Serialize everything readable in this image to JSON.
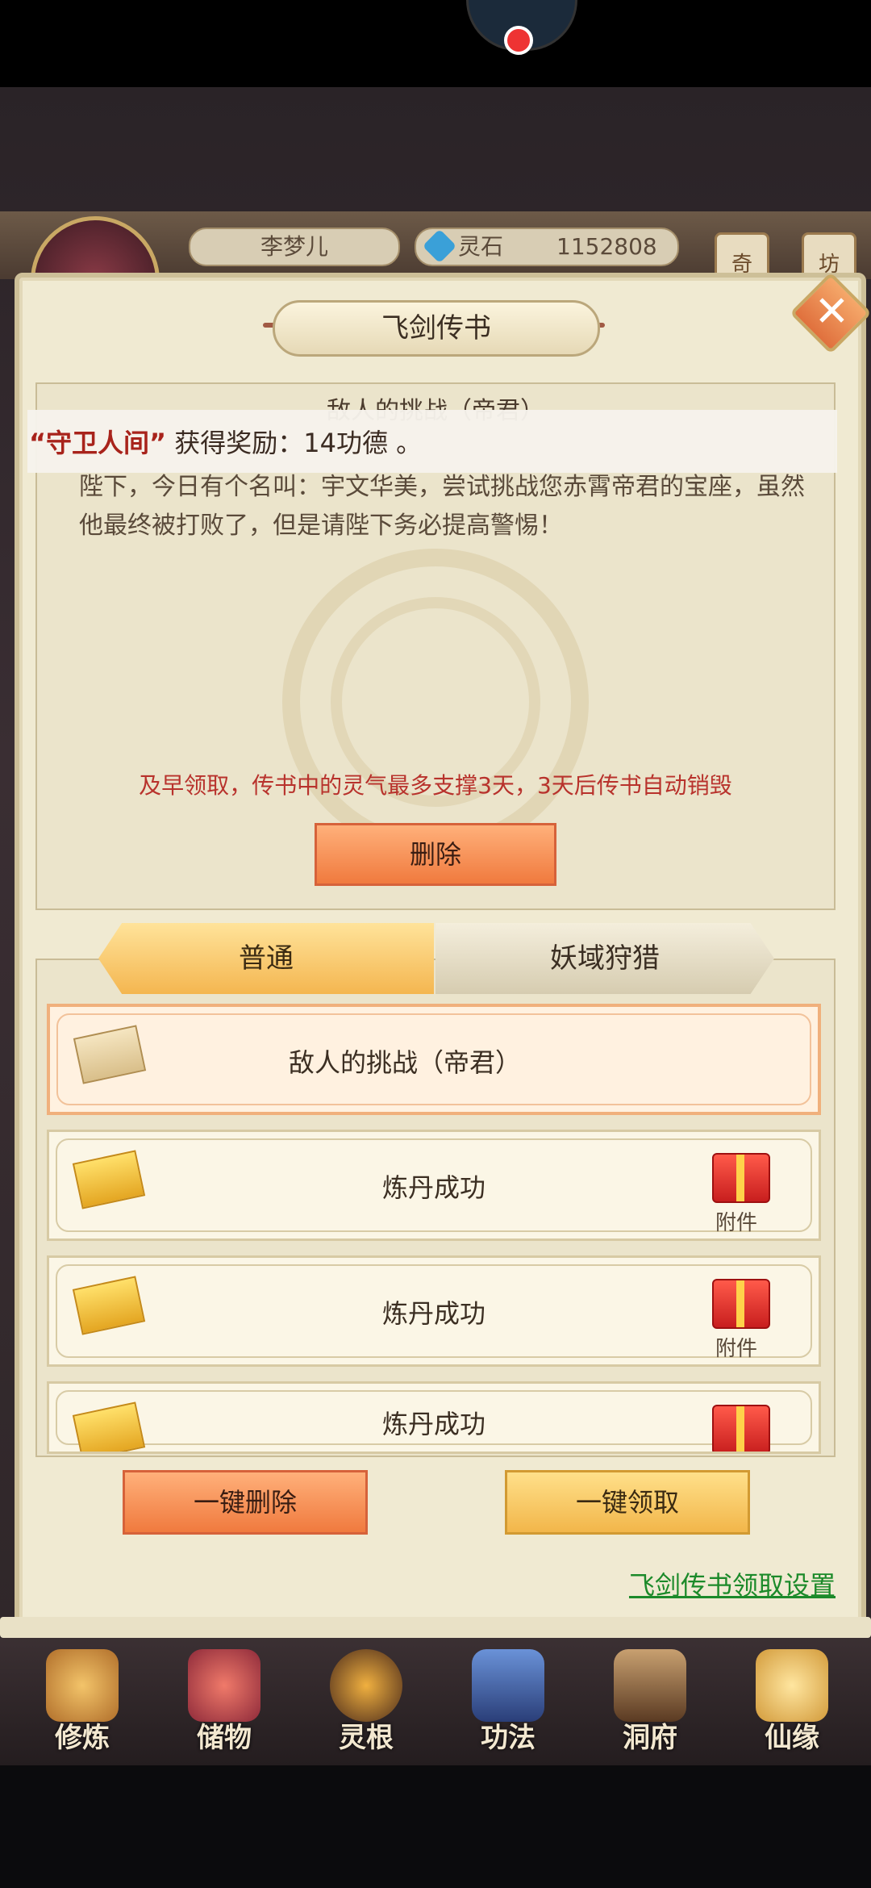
{
  "hud": {
    "player_name": "李梦儿",
    "currency_label": "灵石",
    "currency_value": "1152808",
    "side_badges": [
      "奇",
      "坊"
    ]
  },
  "dialog": {
    "title": "飞剑传书",
    "close_symbol": "✕"
  },
  "notification": {
    "quoted": "“守卫人间”",
    "rest": " 获得奖励：14功德 。"
  },
  "letter": {
    "title": "敌人的挑战（帝君）",
    "body": "陛下，今日有个名叫：宇文华美，尝试挑战您赤霄帝君的宝座，虽然他最终被打败了，但是请陛下务必提高警惕！",
    "warning": "及早领取，传书中的灵气最多支撑3天，3天后传书自动销毁",
    "delete_label": "删除"
  },
  "tabs": [
    {
      "label": "普通",
      "active": true
    },
    {
      "label": "妖域狩猎",
      "active": false
    }
  ],
  "mails": [
    {
      "title": "敌人的挑战（帝君）",
      "opened": true,
      "attachment": ""
    },
    {
      "title": "炼丹成功",
      "opened": false,
      "attachment": "附件"
    },
    {
      "title": "炼丹成功",
      "opened": false,
      "attachment": "附件"
    },
    {
      "title": "炼丹成功",
      "opened": false,
      "attachment": ""
    }
  ],
  "actions": {
    "bulk_delete": "一键删除",
    "bulk_claim": "一键领取",
    "settings_link": "飞剑传书领取设置"
  },
  "nav": [
    {
      "label": "修炼",
      "icon": "cultivate-icon"
    },
    {
      "label": "储物",
      "icon": "storage-bag-icon"
    },
    {
      "label": "灵根",
      "icon": "spirit-root-icon"
    },
    {
      "label": "功法",
      "icon": "technique-book-icon"
    },
    {
      "label": "洞府",
      "icon": "cave-abode-icon"
    },
    {
      "label": "仙缘",
      "icon": "immortal-fate-icon"
    }
  ],
  "colors": {
    "panel": "#f0ead2",
    "accent_orange": "#f07a3e",
    "accent_yellow": "#f2b64a",
    "warning_red": "#b8322c",
    "link_green": "#1c8a2a"
  }
}
